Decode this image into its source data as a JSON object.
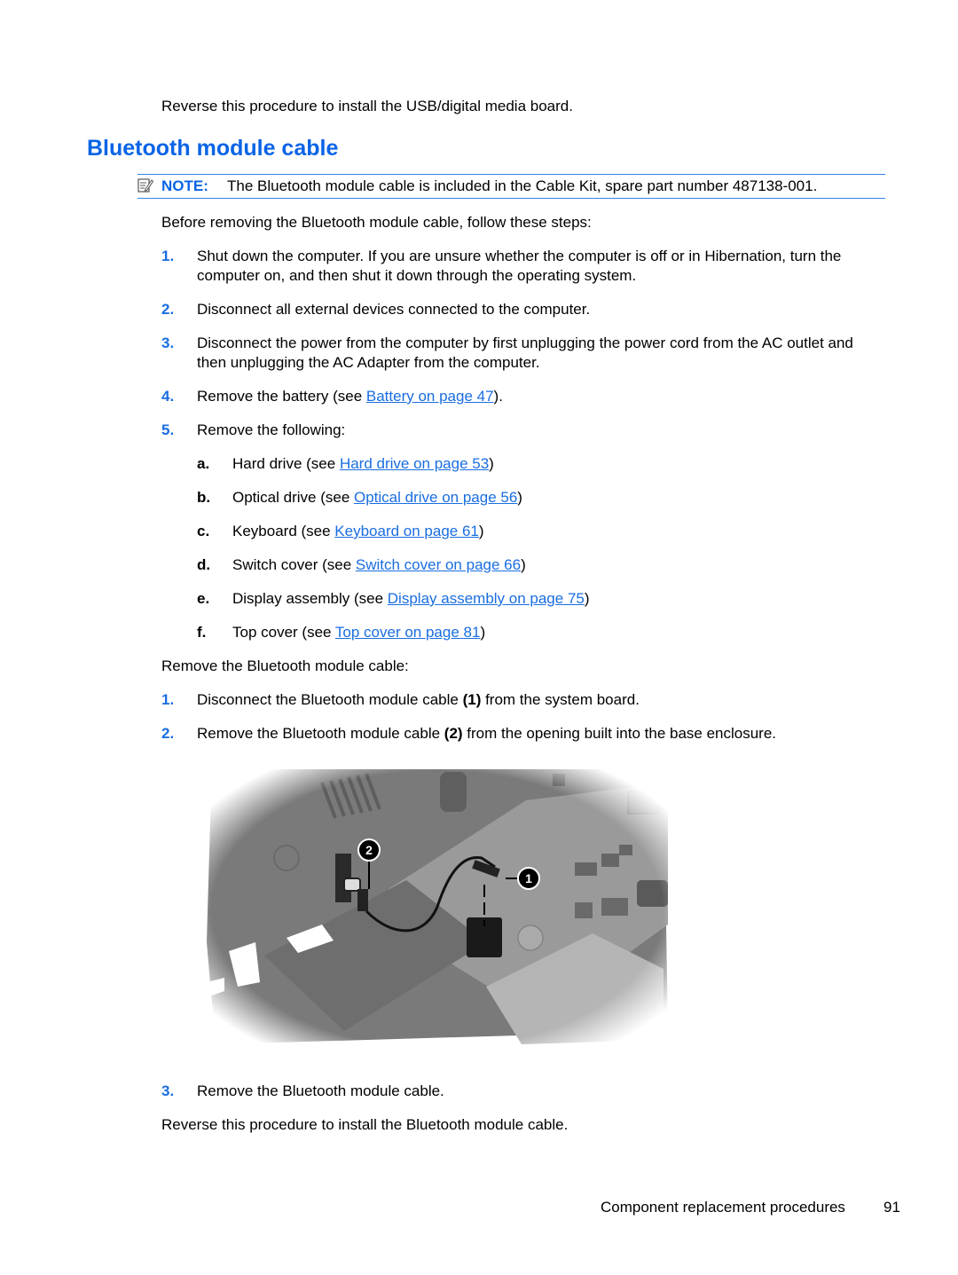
{
  "intro_text": "Reverse this procedure to install the USB/digital media board.",
  "section_title": "Bluetooth module cable",
  "note": {
    "icon": "note-pencil-icon",
    "label": "NOTE:",
    "text": "The Bluetooth module cable is included in the Cable Kit, spare part number 487138-001."
  },
  "before_text": "Before removing the Bluetooth module cable, follow these steps:",
  "prep_steps": [
    {
      "num": "1.",
      "line1": "Shut down the computer. If you are unsure whether the computer is off or in Hibernation, turn the",
      "line2": "computer on, and then shut it down through the operating system."
    },
    {
      "num": "2.",
      "line1": "Disconnect all external devices connected to the computer."
    },
    {
      "num": "3.",
      "line1": "Disconnect the power from the computer by first unplugging the power cord from the AC outlet and",
      "line2": "then unplugging the AC Adapter from the computer."
    },
    {
      "num": "4.",
      "pre": "Remove the battery (see ",
      "link": "Battery on page 47",
      "post": ")."
    },
    {
      "num": "5.",
      "line1": "Remove the following:"
    }
  ],
  "sub_steps": [
    {
      "letter": "a.",
      "pre": "Hard drive (see ",
      "link": "Hard drive on page 53",
      "post": ")"
    },
    {
      "letter": "b.",
      "pre": "Optical drive (see ",
      "link": "Optical drive on page 56",
      "post": ")"
    },
    {
      "letter": "c.",
      "pre": "Keyboard (see ",
      "link": "Keyboard on page 61",
      "post": ")"
    },
    {
      "letter": "d.",
      "pre": "Switch cover (see ",
      "link": "Switch cover on page 66",
      "post": ")"
    },
    {
      "letter": "e.",
      "pre": "Display assembly (see ",
      "link": "Display assembly on page 75",
      "post": ")"
    },
    {
      "letter": "f.",
      "pre": "Top cover (see ",
      "link": "Top cover on page 81",
      "post": ")"
    }
  ],
  "remove_intro": "Remove the Bluetooth module cable:",
  "remove_steps": [
    {
      "num": "1.",
      "pre": "Disconnect the Bluetooth module cable ",
      "bold": "(1)",
      "post": " from the system board."
    },
    {
      "num": "2.",
      "pre": "Remove the Bluetooth module cable ",
      "bold": "(2)",
      "post": " from the opening built into the base enclosure."
    },
    {
      "num": "3.",
      "pre": "Remove the Bluetooth module cable."
    }
  ],
  "figure": {
    "callouts": [
      "1",
      "2"
    ],
    "description": "Bluetooth module cable disconnected from system board and base enclosure"
  },
  "outro_text": "Reverse this procedure to install the Bluetooth module cable.",
  "footer": {
    "section": "Component replacement procedures",
    "page": "91"
  }
}
